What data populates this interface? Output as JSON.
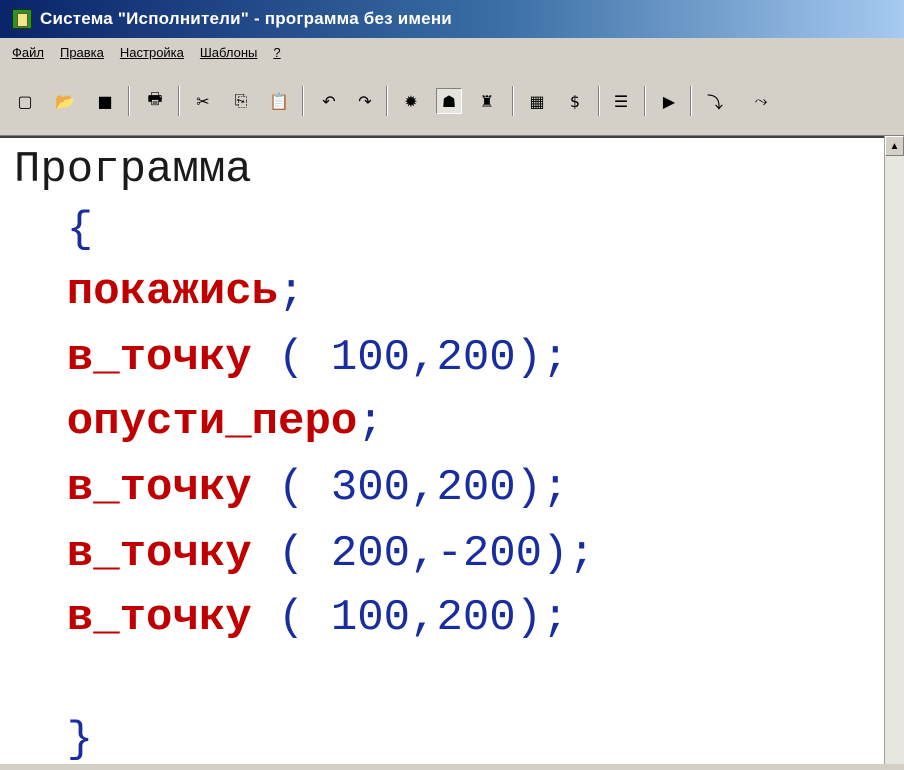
{
  "window": {
    "title": "Система \"Исполнители\" - программа без имени",
    "icon": "app-icon"
  },
  "menu": [
    {
      "label": "Файл"
    },
    {
      "label": "Правка"
    },
    {
      "label": "Настройка"
    },
    {
      "label": "Шаблоны"
    },
    {
      "label": "?"
    }
  ],
  "toolbar": {
    "buttons": [
      {
        "icon": "new-file-icon",
        "glyph": "▢"
      },
      {
        "icon": "open-folder-icon",
        "glyph": "📂"
      },
      {
        "icon": "save-icon",
        "glyph": "■"
      },
      {
        "icon": "print-icon",
        "glyph": "🖶"
      },
      {
        "icon": "cut-icon",
        "glyph": "✂"
      },
      {
        "icon": "copy-icon",
        "glyph": "⎘"
      },
      {
        "icon": "paste-icon",
        "glyph": "📋"
      },
      {
        "icon": "undo-icon",
        "glyph": "↶"
      },
      {
        "icon": "redo-icon",
        "glyph": "↷"
      },
      {
        "icon": "turtle-icon",
        "glyph": "✹"
      },
      {
        "icon": "executor-icon",
        "glyph": "☗",
        "pressed": true
      },
      {
        "icon": "robot-icon",
        "glyph": "♜"
      },
      {
        "icon": "grid-icon",
        "glyph": "▦"
      },
      {
        "icon": "dollar-icon",
        "glyph": "$"
      },
      {
        "icon": "indent-icon",
        "glyph": "☰"
      },
      {
        "icon": "run-icon",
        "glyph": "▶"
      },
      {
        "icon": "step-into-icon",
        "glyph": "⤵"
      },
      {
        "icon": "step-over-icon",
        "glyph": "⤳"
      }
    ]
  },
  "editor": {
    "lines": [
      [
        {
          "text": "Программа",
          "cls": "plain"
        }
      ],
      [
        {
          "text": "  {",
          "cls": "num"
        }
      ],
      [
        {
          "text": "  покажись",
          "cls": "kw"
        },
        {
          "text": ";",
          "cls": "num"
        }
      ],
      [
        {
          "text": "  в_точку",
          "cls": "kw"
        },
        {
          "text": " ( 100,200);",
          "cls": "num"
        }
      ],
      [
        {
          "text": "  опусти_перо",
          "cls": "kw"
        },
        {
          "text": ";",
          "cls": "num"
        }
      ],
      [
        {
          "text": "  в_точку",
          "cls": "kw"
        },
        {
          "text": " ( 300,200);",
          "cls": "num"
        }
      ],
      [
        {
          "text": "  в_точку",
          "cls": "kw"
        },
        {
          "text": " ( 200,-200);",
          "cls": "num"
        }
      ],
      [
        {
          "text": "  в_точку",
          "cls": "kw"
        },
        {
          "text": " ( 100,200);",
          "cls": "num"
        }
      ],
      [],
      [
        {
          "text": "  }",
          "cls": "num"
        }
      ]
    ]
  },
  "colors": {
    "keyword": "#c00000",
    "number": "#1a2d9e",
    "title_bar": "#0a246a"
  }
}
